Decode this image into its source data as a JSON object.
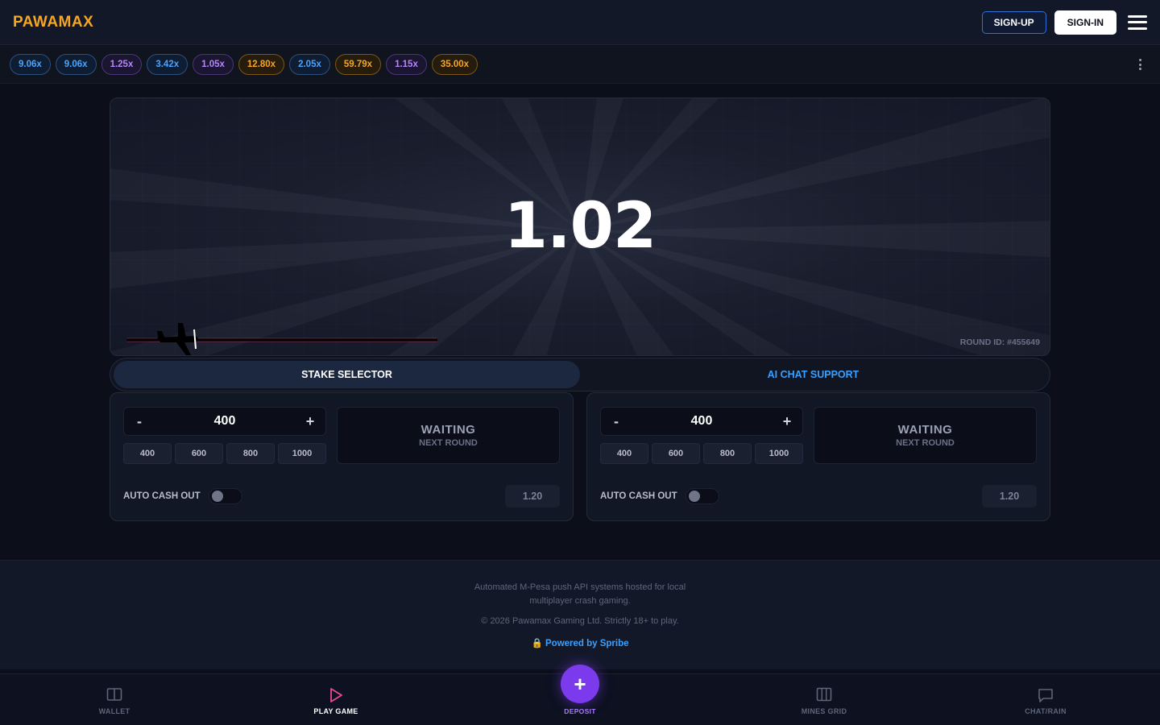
{
  "header": {
    "logo": "PAWAMAX",
    "signup_label": "SIGN-UP",
    "signin_label": "SIGN-IN"
  },
  "history": [
    {
      "value": "9.06x",
      "tone": "blue"
    },
    {
      "value": "9.06x",
      "tone": "blue"
    },
    {
      "value": "1.25x",
      "tone": "purple"
    },
    {
      "value": "3.42x",
      "tone": "blue"
    },
    {
      "value": "1.05x",
      "tone": "purple"
    },
    {
      "value": "12.80x",
      "tone": "gold"
    },
    {
      "value": "2.05x",
      "tone": "blue"
    },
    {
      "value": "59.79x",
      "tone": "gold"
    },
    {
      "value": "1.15x",
      "tone": "purple"
    },
    {
      "value": "35.00x",
      "tone": "gold"
    }
  ],
  "game": {
    "multiplier": "1.02",
    "round_id": "ROUND ID: #455649"
  },
  "tabs": {
    "stake": "STAKE SELECTOR",
    "support": "AI CHAT SUPPORT"
  },
  "panels": [
    {
      "minus": "-",
      "plus": "+",
      "amount": "400",
      "quick": [
        "400",
        "600",
        "800",
        "1000"
      ],
      "status": "WAITING",
      "status_sub": "NEXT ROUND",
      "auto_label": "AUTO CASH OUT",
      "cash_value": "1.20"
    },
    {
      "minus": "-",
      "plus": "+",
      "amount": "400",
      "quick": [
        "400",
        "600",
        "800",
        "1000"
      ],
      "status": "WAITING",
      "status_sub": "NEXT ROUND",
      "auto_label": "AUTO CASH OUT",
      "cash_value": "1.20"
    }
  ],
  "footer": {
    "desc": "Automated M-Pesa push API systems hosted for local multiplayer crash gaming.",
    "copy": "© 2026 Pawamax Gaming Ltd. Strictly 18+ to play.",
    "powered": "Powered by Spribe"
  },
  "nav": {
    "wallet": "WALLET",
    "play": "PLAY GAME",
    "deposit_symbol": "+",
    "deposit": "DEPOSIT",
    "mines": "MINES GRID",
    "chat": "CHAT/RAIN"
  },
  "colors": {
    "brand": "#f5a623",
    "accent": "#7c3aed",
    "link": "#3aa0ff"
  }
}
